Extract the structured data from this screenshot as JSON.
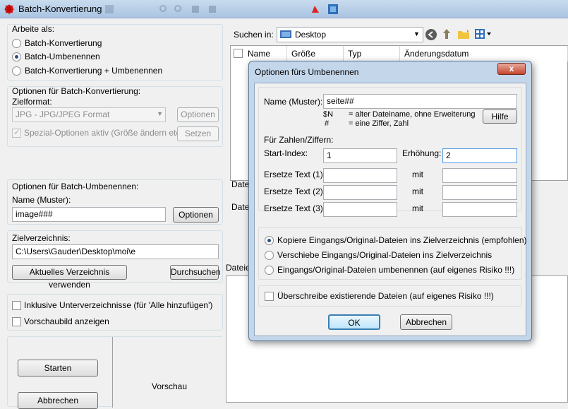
{
  "window": {
    "title": "Batch-Konvertierung",
    "close_label": "x"
  },
  "work_as": {
    "label": "Arbeite als:",
    "options": [
      "Batch-Konvertierung",
      "Batch-Umbenennen",
      "Batch-Konvertierung + Umbenennen"
    ],
    "selected_index": 1
  },
  "convert_options": {
    "label": "Optionen für Batch-Konvertierung:",
    "target_format_label": "Zielformat:",
    "target_format_value": "JPG - JPG/JPEG Format",
    "options_button": "Optionen",
    "special_label": "Spezial-Optionen aktiv (Größe ändern etc.)",
    "special_checked": true,
    "set_button": "Setzen"
  },
  "rename_options": {
    "label": "Optionen für Batch-Umbenennen:",
    "name_label": "Name (Muster):",
    "name_value": "image###",
    "options_button": "Optionen"
  },
  "target_dir": {
    "label": "Zielverzeichnis:",
    "value": "C:\\Users\\Gauder\\Desktop\\moi\\e",
    "use_current_button": "Aktuelles Verzeichnis verwenden",
    "browse_button": "Durchsuchen"
  },
  "checkboxes": {
    "include_sub": "Inklusive Unterverzeichnisse (für 'Alle hinzufügen')",
    "show_preview": "Vorschaubild anzeigen"
  },
  "actions": {
    "start": "Starten",
    "cancel": "Abbrechen",
    "preview": "Vorschau"
  },
  "file_browser": {
    "search_in_label": "Suchen in:",
    "location": "Desktop",
    "columns": [
      "Name",
      "Größe",
      "Typ",
      "Änderungsdatum"
    ],
    "side_label_1": "Datei",
    "side_label_2": "Datei",
    "files_label": "Dateien"
  },
  "dialog": {
    "title": "Optionen fürs Umbenennen",
    "name_label": "Name (Muster):",
    "name_value": "seite##",
    "help_n_key": "$N",
    "help_n_text": "= alter Dateiname, ohne Erweiterung",
    "help_hash_key": "#",
    "help_hash_text": "= eine Ziffer, Zahl",
    "help_button": "Hilfe",
    "numbers_label": "Für Zahlen/Ziffern:",
    "start_index_label": "Start-Index:",
    "start_index_value": "1",
    "increment_label": "Erhöhung:",
    "increment_value": "2",
    "replace_rows": [
      {
        "label": "Ersetze Text (1):",
        "with": "mit",
        "from": "",
        "to": ""
      },
      {
        "label": "Ersetze Text (2):",
        "with": "mit",
        "from": "",
        "to": ""
      },
      {
        "label": "Ersetze Text (3):",
        "with": "mit",
        "from": "",
        "to": ""
      }
    ],
    "file_modes": [
      "Kopiere Eingangs/Original-Dateien ins Zielverzeichnis (empfohlen)",
      "Verschiebe Eingangs/Original-Dateien ins Zielverzeichnis",
      "Eingangs/Original-Dateien umbenennen (auf eigenes Risiko !!!)"
    ],
    "file_mode_selected": 0,
    "overwrite_label": "Überschreibe existierende Dateien (auf eigenes Risiko !!!)",
    "overwrite_checked": false,
    "ok_button": "OK",
    "cancel_button": "Abbrechen"
  },
  "colors": {
    "titlebar": "#b7cfe8",
    "dialog_frame": "#c4d6ea",
    "close_button": "#c5452c"
  }
}
